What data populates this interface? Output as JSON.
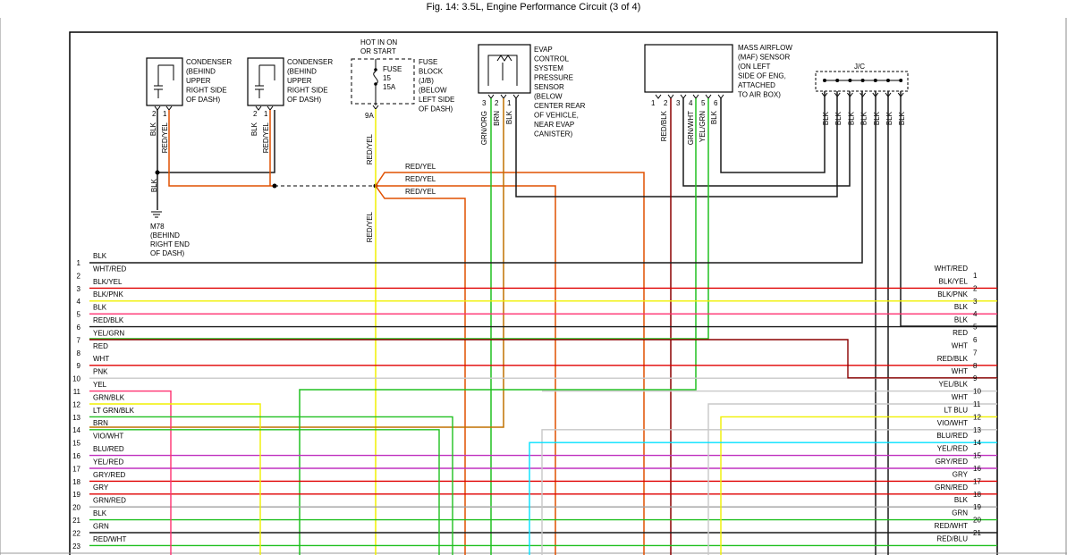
{
  "title": "Fig. 14: 3.5L, Engine Performance Circuit (3 of 4)",
  "components": {
    "condenser1": [
      "CONDENSER",
      "(BEHIND",
      "UPPER",
      "RIGHT SIDE",
      "OF DASH)"
    ],
    "condenser1_pins": [
      "2",
      "1"
    ],
    "condenser1_wires": [
      "BLK",
      "RED/YEL"
    ],
    "condenser2": [
      "CONDENSER",
      "(BEHIND",
      "UPPER",
      "RIGHT SIDE",
      "OF DASH)"
    ],
    "condenser2_pins": [
      "2",
      "1"
    ],
    "condenser2_wires": [
      "BLK",
      "RED/YEL"
    ],
    "fuse_header": [
      "HOT IN ON",
      "OR START"
    ],
    "fuse_label": [
      "FUSE",
      "15",
      "15A"
    ],
    "fuse_block": [
      "FUSE",
      "BLOCK",
      "(J/B)",
      "(BELOW",
      "LEFT SIDE",
      "OF DASH)"
    ],
    "fuse_pin": "9A",
    "fuse_wire": "RED/YEL",
    "fuse_wire_lower": "RED/YEL",
    "fuse_branches": [
      "RED/YEL",
      "RED/YEL",
      "RED/YEL"
    ],
    "ground_wire": "BLK",
    "ground": [
      "M78",
      "(BEHIND",
      "RIGHT END",
      "OF DASH)"
    ],
    "evap": [
      "EVAP",
      "CONTROL",
      "SYSTEM",
      "PRESSURE",
      "SENSOR",
      "(BELOW",
      "CENTER REAR",
      "OF VEHICLE,",
      "NEAR EVAP",
      "CANISTER)"
    ],
    "evap_pins": [
      "3",
      "2",
      "1"
    ],
    "evap_wires": [
      "GRN/ORG",
      "BRN",
      "BLK"
    ],
    "maf": [
      "MASS AIRFLOW",
      "(MAF) SENSOR",
      "(ON LEFT",
      "SIDE OF ENG,",
      "ATTACHED",
      "TO AIR BOX)"
    ],
    "maf_pins": [
      "1",
      "2",
      "3",
      "4",
      "5",
      "6"
    ],
    "maf_wires": [
      "RED/BLK",
      "GRN/WHT",
      "YEL/GRN",
      "BLK"
    ],
    "jc_label": "J/C",
    "jc_wires": [
      "BLK",
      "BLK",
      "BLK",
      "BLK",
      "BLK",
      "BLK",
      "BLK"
    ]
  },
  "left_rows": [
    {
      "n": "1",
      "label": "BLK"
    },
    {
      "n": "2",
      "label": "WHT/RED"
    },
    {
      "n": "3",
      "label": "BLK/YEL"
    },
    {
      "n": "4",
      "label": "BLK/PNK"
    },
    {
      "n": "5",
      "label": "BLK"
    },
    {
      "n": "6",
      "label": "RED/BLK"
    },
    {
      "n": "7",
      "label": "YEL/GRN"
    },
    {
      "n": "8",
      "label": "RED"
    },
    {
      "n": "9",
      "label": "WHT"
    },
    {
      "n": "10",
      "label": "PNK"
    },
    {
      "n": "11",
      "label": "YEL"
    },
    {
      "n": "12",
      "label": "GRN/BLK"
    },
    {
      "n": "13",
      "label": "LT GRN/BLK"
    },
    {
      "n": "14",
      "label": "BRN"
    },
    {
      "n": "15",
      "label": "VIO/WHT"
    },
    {
      "n": "16",
      "label": "BLU/RED"
    },
    {
      "n": "17",
      "label": "YEL/RED"
    },
    {
      "n": "18",
      "label": "GRY/RED"
    },
    {
      "n": "19",
      "label": "GRY"
    },
    {
      "n": "20",
      "label": "GRN/RED"
    },
    {
      "n": "21",
      "label": "BLK"
    },
    {
      "n": "22",
      "label": "GRN"
    },
    {
      "n": "23",
      "label": "RED/WHT"
    }
  ],
  "right_rows": [
    {
      "n": "1",
      "label": "WHT/RED"
    },
    {
      "n": "2",
      "label": "BLK/YEL"
    },
    {
      "n": "3",
      "label": "BLK/PNK"
    },
    {
      "n": "4",
      "label": "BLK"
    },
    {
      "n": "5",
      "label": "BLK"
    },
    {
      "n": "6",
      "label": "RED"
    },
    {
      "n": "7",
      "label": "WHT"
    },
    {
      "n": "8",
      "label": "RED/BLK"
    },
    {
      "n": "9",
      "label": "WHT"
    },
    {
      "n": "10",
      "label": "YEL/BLK"
    },
    {
      "n": "11",
      "label": "WHT"
    },
    {
      "n": "12",
      "label": "LT BLU"
    },
    {
      "n": "13",
      "label": "VIO/WHT"
    },
    {
      "n": "14",
      "label": "BLU/RED"
    },
    {
      "n": "15",
      "label": "YEL/RED"
    },
    {
      "n": "16",
      "label": "GRY/RED"
    },
    {
      "n": "17",
      "label": "GRY"
    },
    {
      "n": "18",
      "label": "GRN/RED"
    },
    {
      "n": "19",
      "label": "BLK"
    },
    {
      "n": "20",
      "label": "GRN"
    },
    {
      "n": "21",
      "label": "RED/WHT"
    },
    {
      "n": "",
      "label": "RED/BLU"
    }
  ],
  "colors": {
    "BLK": "#1a1a1a",
    "WHT": "#c8c8c8",
    "RED": "#e00000",
    "YEL": "#f0f000",
    "GRN": "#20c020",
    "BRN": "#c07000",
    "PNK": "#ff3070",
    "GRY": "#a0a0a0",
    "BLU": "#3060ff",
    "LTBLU": "#00e0ff",
    "VIO": "#c030c0",
    "ORG": "#ff8000",
    "REDYEL": "#e05000",
    "DKRED": "#8b0000"
  }
}
